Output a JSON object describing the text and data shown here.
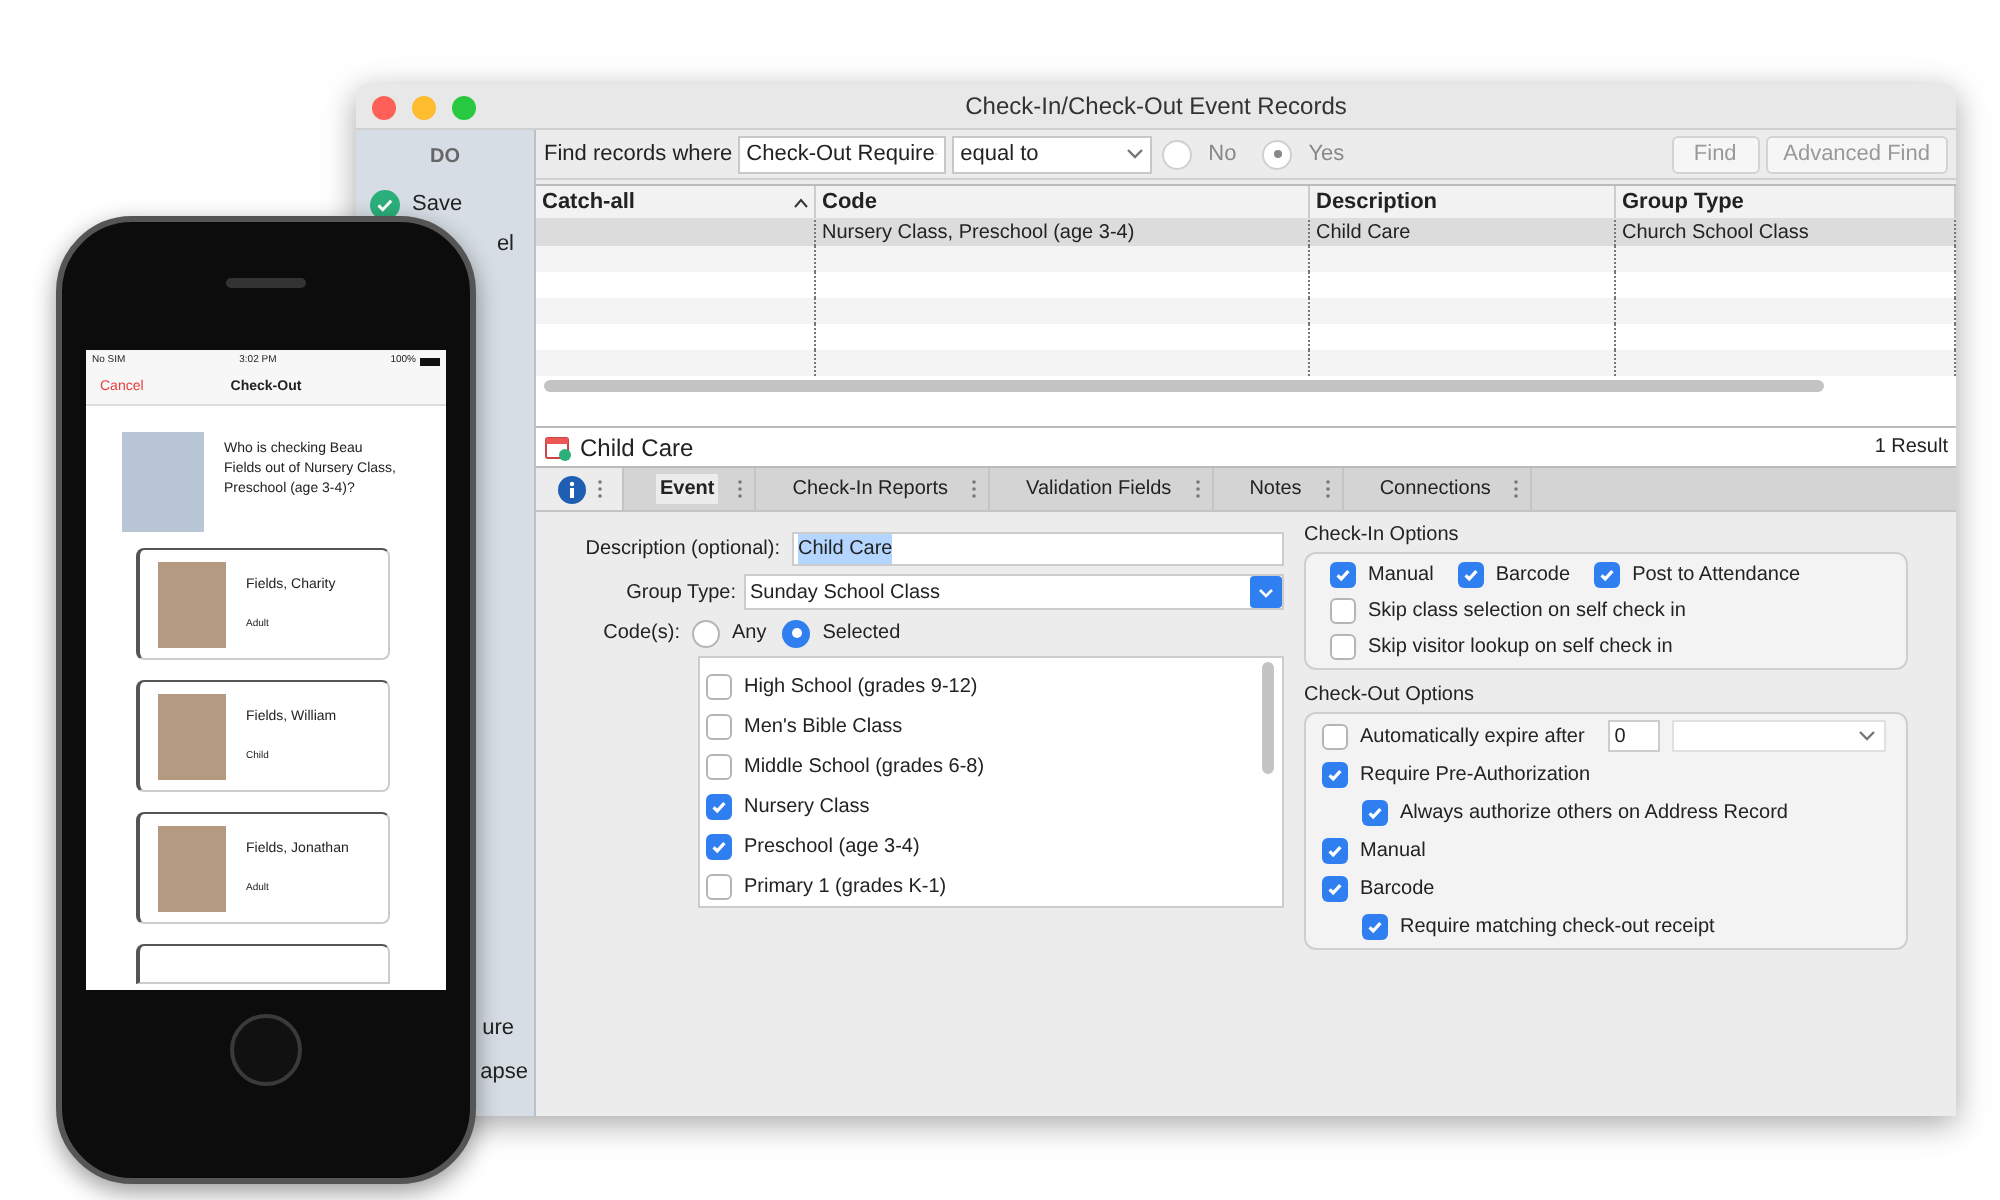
{
  "window": {
    "title": "Check-In/Check-Out Event Records"
  },
  "sidebar": {
    "heading": "DO",
    "items": [
      {
        "label": "Save",
        "kind": "save"
      },
      {
        "label": "el",
        "kind": "text"
      },
      {
        "label": "ure",
        "kind": "text"
      },
      {
        "label": "apse",
        "kind": "text"
      }
    ]
  },
  "find_bar": {
    "label": "Find records where",
    "field": "Check-Out Require",
    "operator": "equal to",
    "options": [
      {
        "label": "No",
        "selected": false
      },
      {
        "label": "Yes",
        "selected": true
      }
    ],
    "buttons": [
      "Find",
      "Advanced Find"
    ]
  },
  "table": {
    "columns": [
      "Catch-all",
      "Code",
      "Description",
      "Group Type"
    ],
    "rows": [
      {
        "cells": [
          "",
          "Nursery Class, Preschool (age 3-4)",
          "Child Care",
          "Church School Class"
        ],
        "selected": true
      }
    ]
  },
  "record": {
    "title": "Child Care",
    "result_count": "1 Result"
  },
  "tabs": [
    {
      "label": "Event",
      "selected": true
    },
    {
      "label": "Check-In Reports",
      "selected": false
    },
    {
      "label": "Validation Fields",
      "selected": false
    },
    {
      "label": "Notes",
      "selected": false
    },
    {
      "label": "Connections",
      "selected": false
    }
  ],
  "form": {
    "description_label": "Description (optional):",
    "description_value": "Child Care",
    "group_type_label": "Group Type:",
    "group_type_value": "Sunday School Class",
    "codes_label": "Code(s):",
    "code_modes": [
      {
        "label": "Any",
        "selected": false
      },
      {
        "label": "Selected",
        "selected": true
      }
    ],
    "codes": [
      {
        "label": "High School (grades 9-12)",
        "checked": false
      },
      {
        "label": "Men's Bible Class",
        "checked": false
      },
      {
        "label": "Middle School (grades 6-8)",
        "checked": false
      },
      {
        "label": "Nursery Class",
        "checked": true
      },
      {
        "label": "Preschool (age 3-4)",
        "checked": true
      },
      {
        "label": "Primary 1 (grades K-1)",
        "checked": false
      }
    ]
  },
  "check_in_options": {
    "title": "Check-In Options",
    "rows": [
      [
        {
          "label": "Manual",
          "checked": true
        },
        {
          "label": "Barcode",
          "checked": true
        },
        {
          "label": "Post to Attendance",
          "checked": true
        }
      ],
      [
        {
          "label": "Skip class selection on self check in",
          "checked": false
        }
      ],
      [
        {
          "label": "Skip visitor lookup on self check in",
          "checked": false
        }
      ]
    ]
  },
  "check_out_options": {
    "title": "Check-Out Options",
    "items": [
      {
        "label": "Automatically expire after",
        "checked": false,
        "kind": "expire",
        "value": "0"
      },
      {
        "label": "Require Pre-Authorization",
        "checked": true,
        "kind": "plain",
        "children": [
          {
            "label": "Always authorize others on Address Record",
            "checked": true
          }
        ]
      },
      {
        "label": "Manual",
        "checked": true,
        "kind": "plain"
      },
      {
        "label": "Barcode",
        "checked": true,
        "kind": "plain",
        "children": [
          {
            "label": "Require matching check-out receipt",
            "checked": true
          }
        ]
      }
    ]
  },
  "phone": {
    "status": {
      "carrier": "No SIM",
      "time": "3:02 PM",
      "battery": "100%"
    },
    "nav": {
      "cancel": "Cancel",
      "title": "Check-Out"
    },
    "question": "Who is checking Beau Fields out of Nursery Class, Preschool (age 3-4)?",
    "people": [
      {
        "name": "Fields, Charity",
        "role": "Adult"
      },
      {
        "name": "Fields, William",
        "role": "Child"
      },
      {
        "name": "Fields, Jonathan",
        "role": "Adult"
      }
    ]
  }
}
